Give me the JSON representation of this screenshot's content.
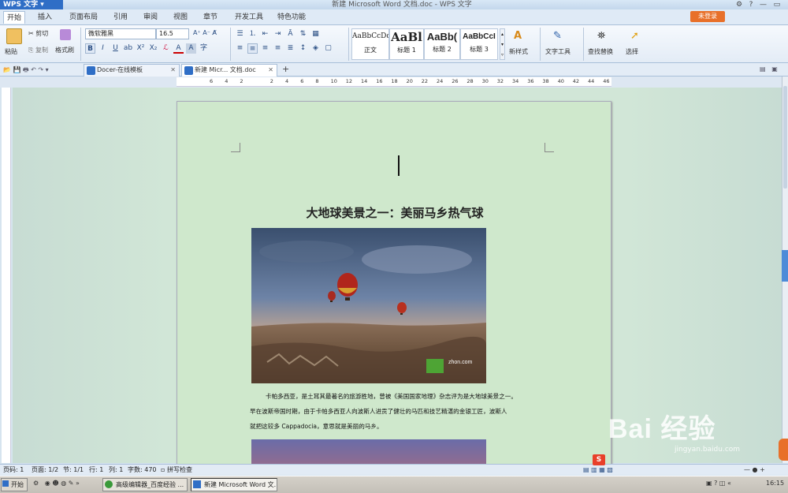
{
  "app": {
    "brand": "WPS 文字",
    "window_title": "新建 Microsoft Word 文档.doc - WPS 文字",
    "login": "未登录"
  },
  "menu": [
    "开始",
    "插入",
    "页面布局",
    "引用",
    "审阅",
    "视图",
    "章节",
    "开发工具",
    "特色功能"
  ],
  "ribbon": {
    "paste": "粘贴",
    "cut": "剪切",
    "copy": "复制",
    "format_painter": "格式刷",
    "font_name": "微软雅黑",
    "font_size": "16.5",
    "styles": [
      {
        "sample": "AaBbCcDd",
        "name": "正文"
      },
      {
        "sample": "AaBl",
        "name": "标题 1"
      },
      {
        "sample": "AaBb(",
        "name": "标题 2"
      },
      {
        "sample": "AaBbCcI",
        "name": "标题 3"
      }
    ],
    "new_style": "新样式",
    "text_tools": "文字工具",
    "find_replace": "查找替换",
    "select": "选择"
  },
  "tabs": [
    "Docer-在线模板",
    "新建 Micr... 文档.doc"
  ],
  "ruler_ticks": [
    "6",
    "4",
    "2",
    "",
    "2",
    "4",
    "6",
    "8",
    "10",
    "12",
    "14",
    "16",
    "18",
    "20",
    "22",
    "24",
    "26",
    "28",
    "30",
    "32",
    "34",
    "36",
    "38",
    "40",
    "42",
    "44",
    "46"
  ],
  "document": {
    "title": "大地球美景之一：美丽马乡热气球",
    "watermark": "zhon.com",
    "paragraph": [
      "卡帕多西亚，是土耳其最著名的旅游胜地，曾被《美国国家地理》杂志评为是大地球美景之一。",
      "早在波斯帝国时期，由于卡帕多西亚人向波斯人进贡了健壮的马匹和技艺精湛的金银工匠，波斯人",
      "就把这较多 Cappadocia，意思就是美丽的马乡。"
    ]
  },
  "status": {
    "page": "页码: 1",
    "pages": "页面: 1/2",
    "section": "节: 1/1",
    "row": "行: 1",
    "col": "列: 1",
    "words": "字数: 470",
    "spell": "拼写检查"
  },
  "taskbar": {
    "start": "开始",
    "items": [
      "高级编辑器_百度经验 ...",
      "新建 Microsoft Word 文..."
    ],
    "time": "16:15"
  },
  "overlay_watermark": {
    "text": "Bai 经验",
    "url": "jingyan.baidu.com"
  }
}
